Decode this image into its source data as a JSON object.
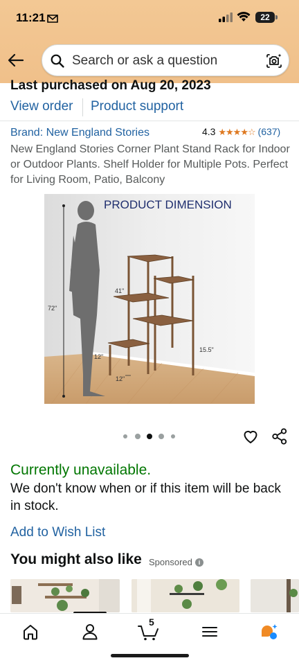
{
  "status_bar": {
    "time": "11:21",
    "battery": "22"
  },
  "search": {
    "placeholder": "Search or ask a question"
  },
  "order": {
    "last_purchased": "Last purchased on Aug 20, 2023",
    "view_order": "View order",
    "product_support": "Product support"
  },
  "product": {
    "brand": "Brand: New England Stories",
    "rating_value": "4.3",
    "rating_stars": 4.3,
    "rating_count": "(637)",
    "title": "New England Stories Corner Plant Stand Rack for Indoor or Outdoor Plants. Shelf Holder for Multiple Pots. Perfect for Living Room, Patio, Balcony",
    "image": {
      "heading": "PRODUCT DIMENSION",
      "dim_height": "72\"",
      "dim_top": "41\"",
      "dim_shelf": "12\"",
      "dim_right": "15.5\"",
      "dim_depth": "12\""
    },
    "image_count": 5,
    "image_index": 3
  },
  "availability": {
    "status": "Currently unavailable.",
    "note": "We don't know when or if this item will be back in stock.",
    "wishlist": "Add to Wish List"
  },
  "recommendations": {
    "heading": "You might also like",
    "sponsored": "Sponsored",
    "info": "i"
  },
  "bottom_nav": {
    "cart_count": "5",
    "items": [
      "home-icon",
      "account-icon",
      "cart-icon",
      "menu-icon",
      "rufus-icon"
    ]
  },
  "colors": {
    "header": "#f0c08a",
    "link": "#2162a1",
    "available_green": "#007600",
    "star": "#de7921"
  }
}
